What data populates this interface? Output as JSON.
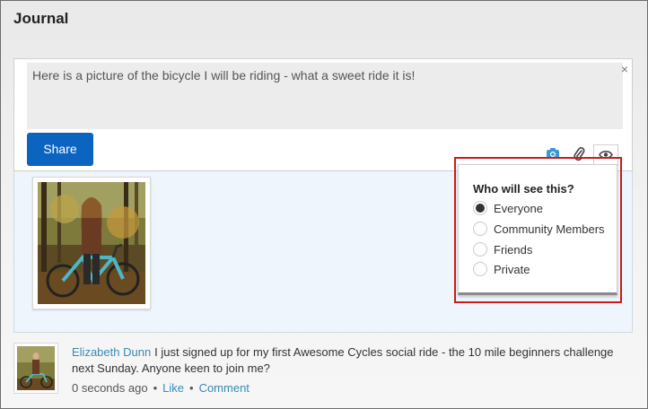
{
  "header": {
    "title": "Journal"
  },
  "composer": {
    "text": "Here is a picture of the bicycle I will be riding - what a sweet ride it is!",
    "close_label": "×",
    "share_label": "Share",
    "icons": [
      "camera-icon",
      "paperclip-icon",
      "eye-icon"
    ]
  },
  "privacy": {
    "title": "Who will see this?",
    "options": [
      {
        "label": "Everyone",
        "selected": true
      },
      {
        "label": "Community Members",
        "selected": false
      },
      {
        "label": "Friends",
        "selected": false
      },
      {
        "label": "Private",
        "selected": false
      }
    ]
  },
  "post": {
    "author": "Elizabeth Dunn",
    "text": "I just signed up for my first Awesome Cycles social ride - the 10 mile beginners challenge next Sunday. Anyone keen to join me?",
    "time": "0 seconds ago",
    "separator": "•",
    "like_label": "Like",
    "comment_label": "Comment"
  },
  "colors": {
    "accent": "#0b64c0",
    "link": "#3a8ab9",
    "highlight": "#cc1b1b",
    "camera": "#3a9ad9"
  }
}
